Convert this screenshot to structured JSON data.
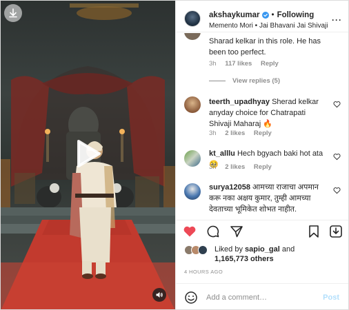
{
  "post": {
    "username": "akshaykumar",
    "follow_label": "Following",
    "dot": "•",
    "audio": "Memento Mori • Jai Bhavani Jai Shivaji",
    "more": "···"
  },
  "comments": [
    {
      "text": "Sharad kelkar in this role. He has been too perfect.",
      "time": "3h",
      "likes": "117 likes",
      "reply": "Reply",
      "view_replies": "View replies (5)"
    },
    {
      "user": "teerth_upadhyay",
      "text": "Sherad kelkar anyday choice for Chatrapati Shivaji Maharaj 🔥",
      "time": "3h",
      "likes": "2 likes",
      "reply": "Reply"
    },
    {
      "user": "kt_alllu",
      "text": "Hech bgyach baki hot ata🥺",
      "time": "3h",
      "likes": "2 likes",
      "reply": "Reply"
    },
    {
      "user": "surya12058",
      "text": "आमच्या राजाचा अपमान करू नका अक्षय कुमार, तुम्ही आमच्या देवताच्या भूमिकेत शोभत नाहीत."
    }
  ],
  "likes": {
    "prefix": "Liked by",
    "user": "sapio_gal",
    "and": "and",
    "count": "1,165,773 others"
  },
  "timestamp": "4 HOURS AGO",
  "add_comment": {
    "placeholder": "Add a comment…",
    "post_label": "Post"
  },
  "colors": {
    "like_red": "#ed4956",
    "link_blue_disabled": "#b2dffc",
    "verified_blue": "#3897f0",
    "muted_text": "#8e8e8e"
  },
  "icons": [
    "download-icon",
    "play-icon",
    "volume-icon",
    "verified-badge-icon",
    "more-icon",
    "heart-icon",
    "comment-icon",
    "share-icon",
    "bookmark-icon",
    "emoji-icon"
  ]
}
